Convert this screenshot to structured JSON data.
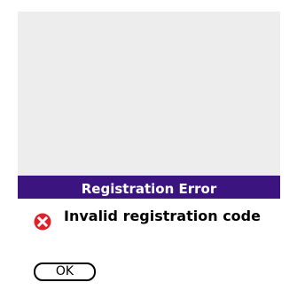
{
  "dialog": {
    "title": "Registration Error",
    "message": "Invalid registration code",
    "icon": "error-icon",
    "ok_label": "OK"
  },
  "colors": {
    "title_bar": "#3b1480",
    "screen_background": "#ededed",
    "error_icon": "#e0212b"
  }
}
